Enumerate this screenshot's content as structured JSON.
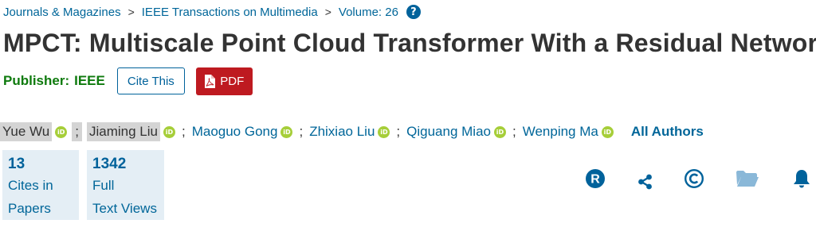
{
  "breadcrumb": {
    "items": [
      "Journals & Magazines",
      "IEEE Transactions on Multimedia",
      "Volume: 26"
    ],
    "separator": ">"
  },
  "title": "MPCT: Multiscale Point Cloud Transformer With a Residual Network",
  "publisher": {
    "label": "Publisher:",
    "name": "IEEE",
    "cite_label": "Cite This",
    "pdf_label": "PDF"
  },
  "authors": {
    "names": [
      "Yue Wu",
      "Jiaming Liu",
      "Maoguo Gong",
      "Zhixiao Liu",
      "Qiguang Miao",
      "Wenping Ma"
    ],
    "separator": ";",
    "all_authors_label": "All Authors"
  },
  "metrics": [
    {
      "value": "13",
      "line1": "Cites in",
      "line2": "Papers"
    },
    {
      "value": "1342",
      "line1": "Full",
      "line2": "Text Views"
    }
  ],
  "icons": {
    "help": "question-icon",
    "orcid": "orcid-icon",
    "actions": [
      "rights-permissions-icon",
      "share-icon",
      "copyright-icon",
      "folder-icon",
      "bell-alert-icon"
    ]
  },
  "colors": {
    "link": "#006699",
    "brand_blue": "#00629b",
    "publisher_green": "#0e7a0d",
    "pdf_red": "#be1a20",
    "orcid_green": "#a6ce39",
    "metric_bg": "#e4eef5"
  }
}
